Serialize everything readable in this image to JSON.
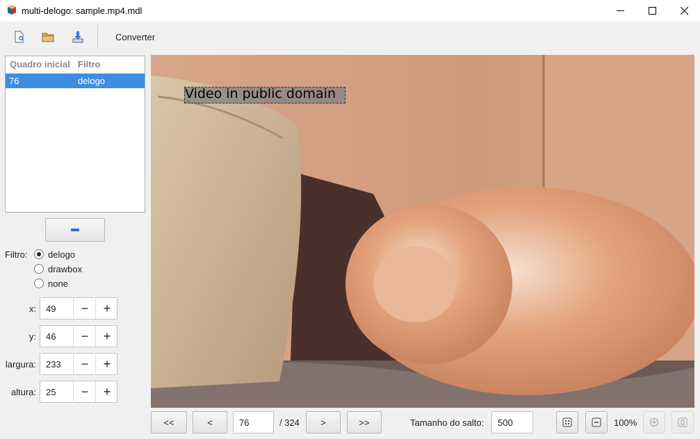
{
  "window": {
    "title": "multi-delogo: sample.mp4.mdl"
  },
  "toolbar": {
    "converter_label": "Converter"
  },
  "filter_list": {
    "headers": [
      "Quadro inicial",
      "Filtro"
    ],
    "rows": [
      {
        "frame": "76",
        "filter": "delogo"
      }
    ]
  },
  "filter_options": {
    "label": "Filtro:",
    "options": [
      "delogo",
      "drawbox",
      "none"
    ],
    "selected": "delogo"
  },
  "fields": {
    "x": {
      "label": "x:",
      "value": "49"
    },
    "y": {
      "label": "y:",
      "value": "46"
    },
    "width": {
      "label": "largura:",
      "value": "233"
    },
    "height": {
      "label": "altura:",
      "value": "25"
    }
  },
  "video": {
    "overlay_text": "Video in public domain"
  },
  "navigation": {
    "first_label": "<<",
    "prev_label": "<",
    "next_label": ">",
    "last_label": ">>",
    "current_frame": "76",
    "total_frames": "/ 324",
    "jump_label": "Tamanho do salto:",
    "jump_value": "500",
    "zoom": "100%"
  },
  "icons": {
    "app": "app-cube-icon",
    "new": "new-file-icon",
    "open": "open-folder-icon",
    "save": "save-icon",
    "remove": "minus-icon",
    "zoom_fit": "zoom-fit-icon",
    "zoom_out": "zoom-out-icon",
    "zoom_in": "zoom-in-icon",
    "zoom_reset": "zoom-reset-icon"
  },
  "colors": {
    "selection": "#3d8ee0",
    "toolbar_bg": "#f0f0f0"
  }
}
